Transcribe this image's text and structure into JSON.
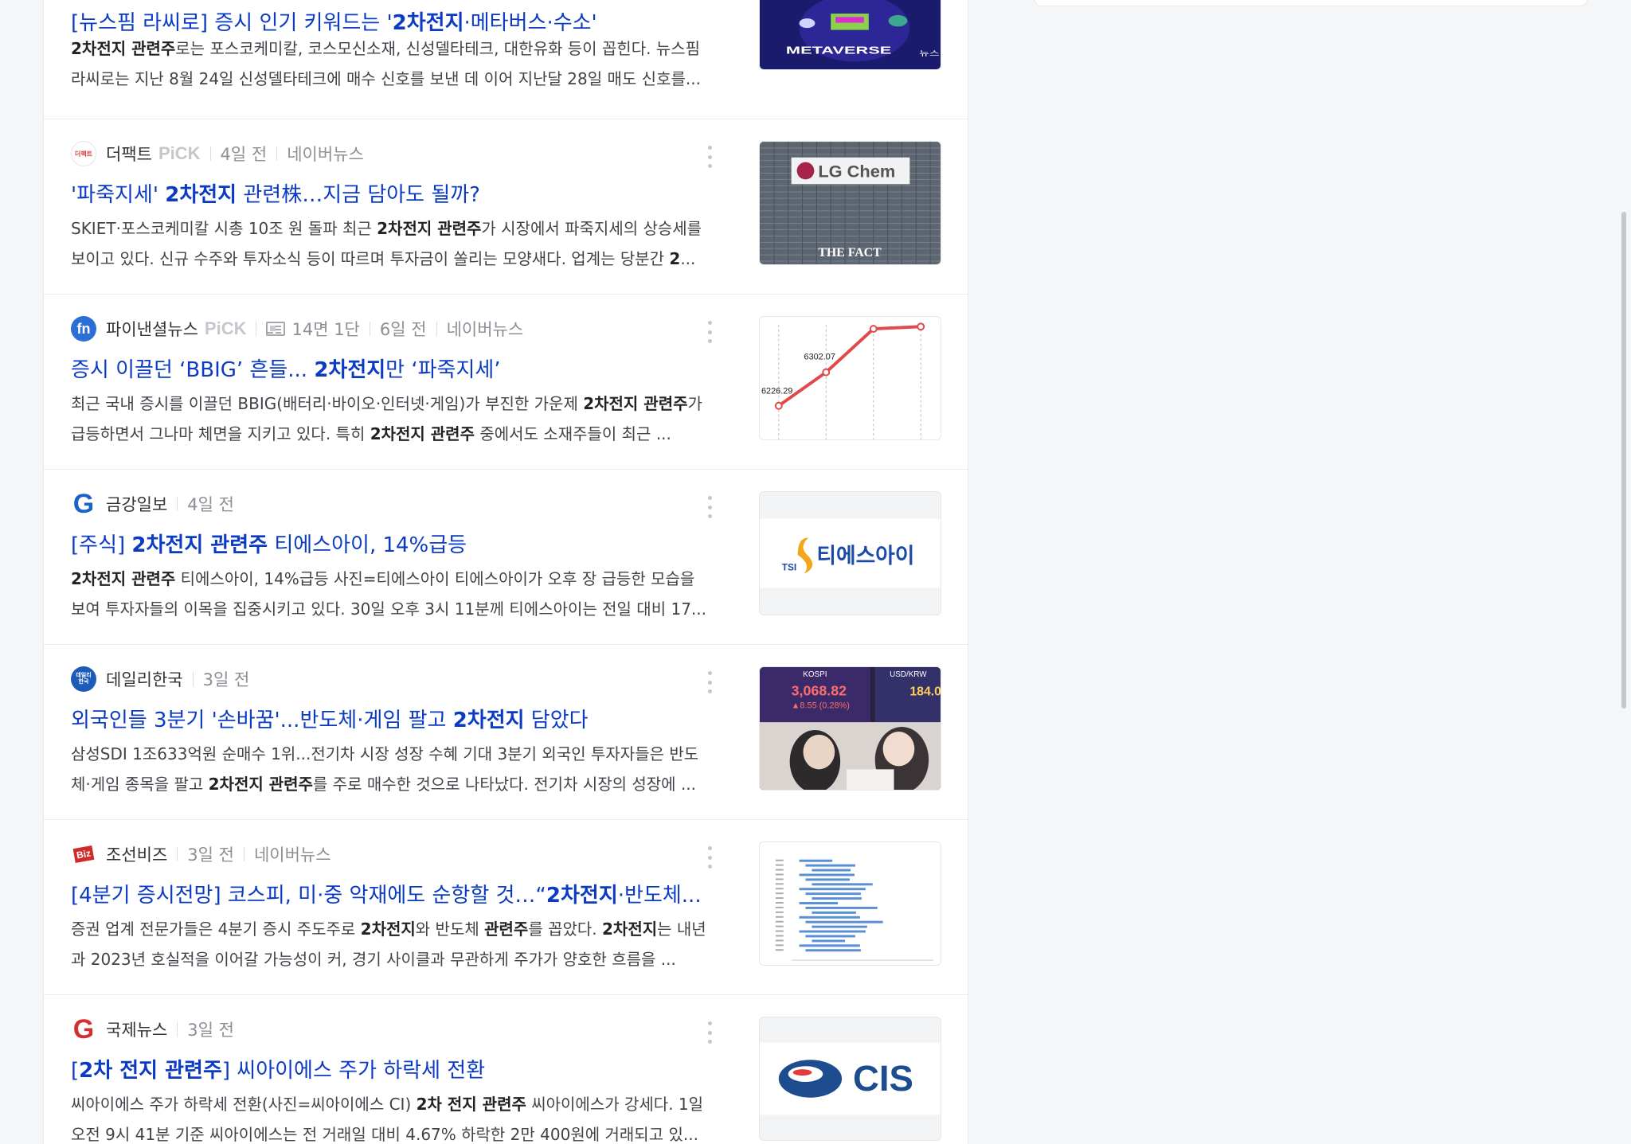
{
  "articles": [
    {
      "press": "",
      "headline": {
        "pre": "[뉴스핌 라씨로] 증시 인기 키워드는 '",
        "bold": "2차전지",
        "post": "·메타버스·수소'"
      },
      "snippet": [
        {
          "b": "2차전지 관련주"
        },
        {
          "t": "로는 포스코케미칼, 코스모신소재, 신성델타테크, 대한유화 등이 꼽힌다. 뉴스핌 라씨로는 지난 8월 24일 신성델타테크에 매수 신호를 보낸 데 이어 지난달 28일 매도 신호를..."
        }
      ],
      "thumb": {
        "kind": "metaverse",
        "text": "METAVERSE",
        "badge": "뉴스"
      }
    },
    {
      "logo_text": "더팩트",
      "press": "더팩트",
      "pick": "PiCK",
      "time": "4일 전",
      "source": "네이버뉴스",
      "headline": {
        "pre": "'파죽지세' ",
        "bold": "2차전지",
        "post": " 관련株…지금 담아도 될까?"
      },
      "snippet": [
        {
          "t": "SKIET·포스코케미칼 시총 10조 원 돌파 최근 "
        },
        {
          "b": "2차전지 관련주"
        },
        {
          "t": "가 시장에서 파죽지세의 상승세를 보이고 있다. 신규 수주와 투자소식 등이 따르며 투자금이 쏠리는 모양새다. 업계는 당분간 "
        },
        {
          "b": "2"
        },
        {
          "t": "..."
        }
      ],
      "thumb": {
        "kind": "lgchem",
        "text": "LG Chem",
        "caption": "THE FACT"
      }
    },
    {
      "logo_text": "fn",
      "press": "파이낸셜뉴스",
      "pick": "PiCK",
      "paper": "14면 1단",
      "time": "6일 전",
      "source": "네이버뉴스",
      "headline": {
        "pre": "증시 이끌던 ‘BBIG’ 흔들... ",
        "bold": "2차전지",
        "post": "만 ‘파죽지세’"
      },
      "snippet": [
        {
          "t": "최근 국내 증시를 이끌던 BBIG(배터리·바이오·인터넷·게임)가 부진한 가운제 "
        },
        {
          "b": "2차전지 관련주"
        },
        {
          "t": "가 급등하면서 그나마 체면을 지키고 있다. 특히 "
        },
        {
          "b": "2차전지 관련주"
        },
        {
          "t": " 중에서도 소재주들이 최근 ..."
        }
      ],
      "thumb": {
        "kind": "linechart",
        "labels": [
          "6226.29",
          "6302.07"
        ],
        "values": [
          6226.29,
          6302.07,
          6400,
          6405
        ]
      }
    },
    {
      "logo_text": "G",
      "press": "금강일보",
      "time": "4일 전",
      "headline": {
        "pre": "[주식] ",
        "bold": "2차전지 관련주",
        "post": " 티에스아이, 14%급등"
      },
      "snippet": [
        {
          "b": "2차전지 관련주"
        },
        {
          "t": " 티에스아이, 14%급등 사진=티에스아이 티에스아이가 오후 장 급등한 모습을 보여 투자자들의 이목을 집중시키고 있다. 30일 오후 3시 11분께 티에스아이는 전일 대비 17..."
        }
      ],
      "thumb": {
        "kind": "tsi",
        "text": "티에스아이",
        "small": "TSI"
      }
    },
    {
      "logo_text": "데일리한국",
      "press": "데일리한국",
      "time": "3일 전",
      "headline": {
        "pre": "외국인들 3분기 '손바꿈'...반도체·게임 팔고 ",
        "bold": "2차전지",
        "post": " 담았다"
      },
      "snippet": [
        {
          "t": "삼성SDI 1조633억원 순매수 1위...전기차 시장 성장 수혜 기대 3분기 외국인 투자자들은 반도체·게임 종목을 팔고 "
        },
        {
          "b": "2차전지 관련주"
        },
        {
          "t": "를 주로 매수한 것으로 나타났다. 전기차 시장의 성장에 ..."
        }
      ],
      "thumb": {
        "kind": "market",
        "kospi": "KOSPI",
        "value": "3,068.82",
        "change": "▲8.55 (0.28%)",
        "fx": "USD/KRW",
        "fxval": "184.0"
      }
    },
    {
      "logo_text": "Biz",
      "press": "조선비즈",
      "time": "3일 전",
      "source": "네이버뉴스",
      "headline": {
        "pre": "[4분기 증시전망] 코스피, 미·중 악재에도 순항할 것…“",
        "bold": "2차전지",
        "post": "·반도체..."
      },
      "snippet": [
        {
          "t": "증권 업계 전문가들은 4분기 증시 주도주로 "
        },
        {
          "b": "2차전지"
        },
        {
          "t": "와 반도체 "
        },
        {
          "b": "관련주"
        },
        {
          "t": "를 꼽았다. "
        },
        {
          "b": "2차전지"
        },
        {
          "t": "는 내년과 2023년 호실적을 이어갈 가능성이 커, 경기 사이클과 무관하게 주가가 양호한 흐름을 ..."
        }
      ],
      "thumb": {
        "kind": "hbars",
        "values": [
          0.3,
          0.45,
          0.35,
          0.5,
          0.4,
          0.55,
          0.6,
          0.5,
          0.45,
          0.35,
          0.65,
          0.4,
          0.55,
          0.7,
          0.5,
          0.6,
          0.45,
          0.3,
          0.55,
          0.5
        ]
      }
    },
    {
      "logo_text": "G",
      "press": "국제뉴스",
      "time": "3일 전",
      "headline": {
        "pre": "[",
        "bold": "2차 전지 관련주",
        "post": "] 씨아이에스 주가 하락세 전환"
      },
      "snippet": [
        {
          "t": "씨아이에스 주가 하락세 전환(사진=씨아이에스 CI) "
        },
        {
          "b": "2차 전지 관련주"
        },
        {
          "t": " 씨아이에스가 강세다. 1일 오전 9시 41분 기준 씨아이에스는 전 거래일 대비 4.67% 하락한 2만 400원에 거래되고 있..."
        }
      ],
      "thumb": {
        "kind": "cis",
        "text": "CIS"
      }
    }
  ],
  "colors": {
    "link": "#0b3bc4",
    "fn_logo": "#2b6fd6",
    "geumgang_logo": "#1a63c6",
    "daily_logo": "#1d5bb8",
    "chosun_logo": "#d12a2a",
    "gukje_logo": "#d32f2f",
    "chart_line": "#e04a4a"
  }
}
